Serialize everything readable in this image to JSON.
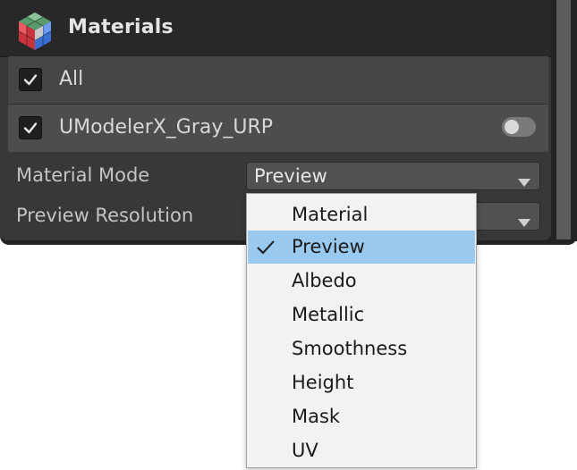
{
  "window": {
    "title": "Materials",
    "icon": "cube-grid-icon"
  },
  "toggles": {
    "all_label": "All",
    "all_checked": true,
    "material_label": "UModelerX_Gray_URP",
    "material_checked": true,
    "material_switch_on": false
  },
  "properties": {
    "material_mode_label": "Material Mode",
    "material_mode_value": "Preview",
    "preview_resolution_label": "Preview Resolution"
  },
  "menu": {
    "selected": "Preview",
    "items": [
      "Material",
      "Preview",
      "Albedo",
      "Metallic",
      "Smoothness",
      "Height",
      "Mask",
      "UV"
    ]
  },
  "colors": {
    "panel_bg": "#383838",
    "header_bg": "#282828",
    "menu_bg": "#f2f2f2",
    "menu_highlight": "#99c9ef"
  }
}
